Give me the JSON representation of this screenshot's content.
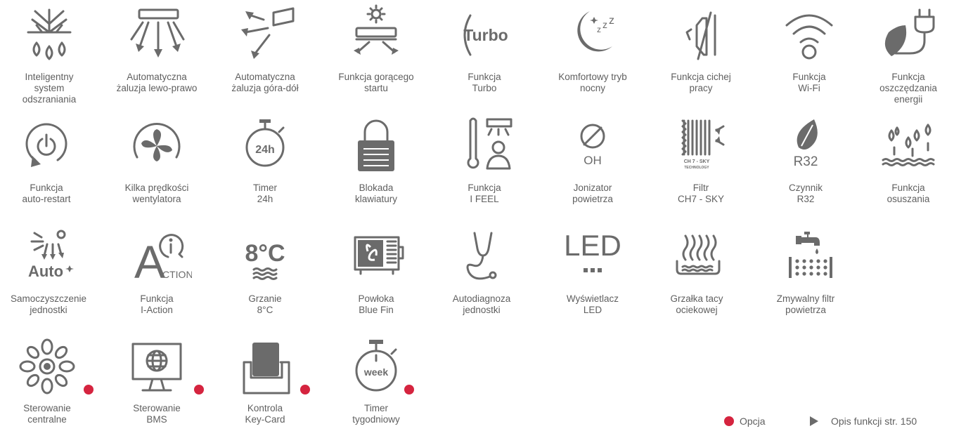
{
  "features": [
    {
      "icon": "defrost-icon",
      "label": "Inteligentny\nsystem\nodszraniania",
      "option": false
    },
    {
      "icon": "louver-left-right-icon",
      "label": "Automatyczna\nżaluzja lewo-prawo",
      "option": false
    },
    {
      "icon": "louver-up-down-icon",
      "label": "Automatyczna\nżaluzja góra-dół",
      "option": false
    },
    {
      "icon": "hot-start-icon",
      "label": "Funkcja gorącego\nstartu",
      "option": false
    },
    {
      "icon": "turbo-icon",
      "label": "Funkcja\nTurbo",
      "option": false,
      "icon_text": "Turbo"
    },
    {
      "icon": "night-mode-icon",
      "label": "Komfortowy tryb\nnocny",
      "option": false
    },
    {
      "icon": "quiet-mode-icon",
      "label": "Funkcja cichej\npracy",
      "option": false
    },
    {
      "icon": "wifi-icon",
      "label": "Funkcja\nWi-Fi",
      "option": false
    },
    {
      "icon": "energy-saving-icon",
      "label": "Funkcja\noszczędzania\nenergii",
      "option": false
    },
    {
      "icon": "auto-restart-icon",
      "label": "Funkcja\nauto-restart",
      "option": false
    },
    {
      "icon": "fan-speeds-icon",
      "label": "Kilka prędkości\nwentylatora",
      "option": false
    },
    {
      "icon": "timer-24h-icon",
      "label": "Timer\n24h",
      "option": false,
      "icon_text": "24h"
    },
    {
      "icon": "keypad-lock-icon",
      "label": "Blokada\nklawiatury",
      "option": false
    },
    {
      "icon": "i-feel-icon",
      "label": "Funkcja\nI FEEL",
      "option": false
    },
    {
      "icon": "ionizer-icon",
      "label": "Jonizator\npowietrza",
      "option": false,
      "icon_text": "OH"
    },
    {
      "icon": "filter-ch7-sky-icon",
      "label": "Filtr\nCH7 - SKY",
      "option": false,
      "icon_text": "CH 7 - SKY",
      "icon_subtext": "TECHNOLOGY"
    },
    {
      "icon": "refrigerant-r32-icon",
      "label": "Czynnik\nR32",
      "option": false,
      "icon_text": "R32"
    },
    {
      "icon": "dehumidify-icon",
      "label": "Funkcja\nosuszania",
      "option": false
    },
    {
      "icon": "self-clean-icon",
      "label": "Samoczyszczenie\njednostki",
      "option": false,
      "icon_text": "Auto"
    },
    {
      "icon": "i-action-icon",
      "label": "Funkcja\nI-Action",
      "option": false,
      "icon_text": "A",
      "icon_subtext": "CTION"
    },
    {
      "icon": "heating-8c-icon",
      "label": "Grzanie\n8°C",
      "option": false,
      "icon_text": "8°C"
    },
    {
      "icon": "blue-fin-icon",
      "label": "Powłoka\nBlue Fin",
      "option": false
    },
    {
      "icon": "self-diagnosis-icon",
      "label": "Autodiagnoza\njednostki",
      "option": false
    },
    {
      "icon": "led-display-icon",
      "label": "Wyświetlacz\nLED",
      "option": false,
      "icon_text": "LED"
    },
    {
      "icon": "drain-pan-heater-icon",
      "label": "Grzałka tacy\nociekowej",
      "option": false
    },
    {
      "icon": "washable-filter-icon",
      "label": "Zmywalny filtr\npowietrza",
      "option": false
    },
    {
      "icon": "central-control-icon",
      "label": "Sterowanie\ncentralne",
      "option": true
    },
    {
      "icon": "bms-control-icon",
      "label": "Sterowanie\nBMS",
      "option": true
    },
    {
      "icon": "key-card-icon",
      "label": "Kontrola\nKey-Card",
      "option": true
    },
    {
      "icon": "weekly-timer-icon",
      "label": "Timer\ntygodniowy",
      "option": true,
      "icon_text": "week"
    }
  ],
  "legend": {
    "option_label": "Opcja",
    "description_label": "Opis funkcji str. 150"
  },
  "colors": {
    "icon": "#6b6b6b",
    "text": "#5f5f5f",
    "option_dot": "#d5243f"
  }
}
